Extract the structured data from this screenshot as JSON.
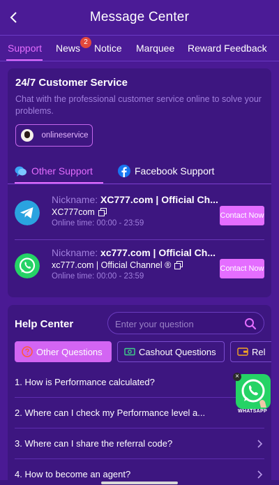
{
  "header": {
    "title": "Message Center",
    "back_icon": "chevron-left-icon"
  },
  "tabs": [
    {
      "label": "Support",
      "active": true
    },
    {
      "label": "News",
      "badge": "2"
    },
    {
      "label": "Notice"
    },
    {
      "label": "Marquee"
    },
    {
      "label": "Reward Feedback"
    }
  ],
  "customer_service": {
    "title": "24/7 Customer Service",
    "description": "Chat with the professional customer service online to solve your problems.",
    "online_label": "onlineservice",
    "subtabs": [
      {
        "label": "Other Support",
        "icon": "chat-bubble-icon",
        "active": true
      },
      {
        "label": "Facebook Support",
        "icon": "facebook-icon"
      }
    ],
    "contacts": [
      {
        "icon": "telegram-icon",
        "nickname_label": "Nickname:",
        "nickname": "XC777.com | Official Ch...",
        "account": "XC777com",
        "online_time": "Online time: 00:00 - 23:59",
        "button": "Contact Now"
      },
      {
        "icon": "whatsapp-icon",
        "nickname_label": "Nickname:",
        "nickname": "xc777.com | Official Ch...",
        "account": "xc777.com | Official Channel ®",
        "online_time": "Online time: 00:00 - 23:59",
        "button": "Contact Now"
      }
    ]
  },
  "help_center": {
    "title": "Help Center",
    "search_placeholder": "Enter your question",
    "question_tabs": [
      {
        "label": "Other Questions",
        "icon": "question-circle-icon",
        "active": true
      },
      {
        "label": "Cashout Questions",
        "icon": "cash-icon"
      },
      {
        "label": "Rel",
        "icon": "wallet-icon"
      }
    ],
    "questions": [
      "1. How is Performance calculated?",
      "2. Where can I check my Performance level a...",
      "3. Where can I share the referral code?",
      "4. How to become an agent?"
    ]
  },
  "floating_whatsapp": {
    "label": "WHATSAPP",
    "close": "×"
  },
  "colors": {
    "background": "#4a1a94",
    "card": "#3d1680",
    "accent": "#e46dff",
    "muted": "#a07fdc"
  }
}
